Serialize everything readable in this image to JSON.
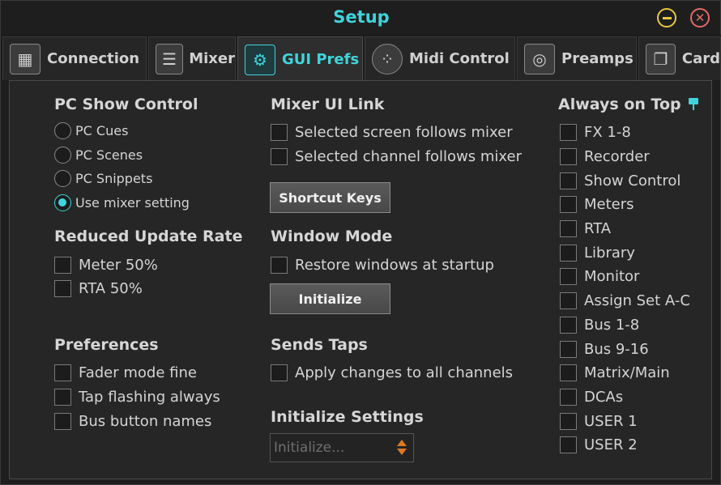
{
  "window": {
    "title": "Setup"
  },
  "tabs": [
    {
      "label": "Connection",
      "icon": "connection-icon"
    },
    {
      "label": "Mixer",
      "icon": "mixer-faders-icon"
    },
    {
      "label": "GUI Prefs",
      "icon": "gears-icon",
      "active": true
    },
    {
      "label": "Midi Control",
      "icon": "midi-din-icon"
    },
    {
      "label": "Preamps",
      "icon": "preamp-knob-icon"
    },
    {
      "label": "Card",
      "icon": "card-icon"
    }
  ],
  "pc_show_control": {
    "heading": "PC Show Control",
    "options": [
      {
        "label": "PC Cues",
        "selected": false
      },
      {
        "label": "PC Scenes",
        "selected": false
      },
      {
        "label": "PC Snippets",
        "selected": false
      },
      {
        "label": "Use mixer setting",
        "selected": true
      }
    ]
  },
  "reduced_update_rate": {
    "heading": "Reduced Update Rate",
    "items": [
      {
        "label": "Meter 50%",
        "checked": false
      },
      {
        "label": "RTA 50%",
        "checked": false
      }
    ]
  },
  "preferences": {
    "heading": "Preferences",
    "items": [
      {
        "label": "Fader mode fine",
        "checked": false
      },
      {
        "label": "Tap flashing always",
        "checked": false
      },
      {
        "label": "Bus button names",
        "checked": false
      }
    ]
  },
  "mixer_ui_link": {
    "heading": "Mixer UI Link",
    "items": [
      {
        "label": "Selected screen follows mixer",
        "checked": false
      },
      {
        "label": "Selected channel follows mixer",
        "checked": false
      }
    ],
    "shortcut_button": "Shortcut Keys"
  },
  "window_mode": {
    "heading": "Window Mode",
    "items": [
      {
        "label": "Restore windows at startup",
        "checked": false
      }
    ],
    "initialize_button": "Initialize"
  },
  "sends_taps": {
    "heading": "Sends Taps",
    "items": [
      {
        "label": "Apply changes to all channels",
        "checked": false
      }
    ]
  },
  "initialize_settings": {
    "heading": "Initialize Settings",
    "placeholder": "Initialize..."
  },
  "always_on_top": {
    "heading": "Always on Top",
    "icon": "pin-icon",
    "items": [
      {
        "label": "FX 1-8",
        "checked": false
      },
      {
        "label": "Recorder",
        "checked": false
      },
      {
        "label": "Show Control",
        "checked": false
      },
      {
        "label": "Meters",
        "checked": false
      },
      {
        "label": "RTA",
        "checked": false
      },
      {
        "label": "Library",
        "checked": false
      },
      {
        "label": "Monitor",
        "checked": false
      },
      {
        "label": "Assign Set A-C",
        "checked": false
      },
      {
        "label": "Bus 1-8",
        "checked": false
      },
      {
        "label": "Bus 9-16",
        "checked": false
      },
      {
        "label": "Matrix/Main",
        "checked": false
      },
      {
        "label": "DCAs",
        "checked": false
      },
      {
        "label": "USER 1",
        "checked": false
      },
      {
        "label": "USER 2",
        "checked": false
      }
    ]
  },
  "colors": {
    "accent": "#3fd4dc",
    "minimize": "#e8c840",
    "close": "#e46a6a",
    "select_arrow": "#e07820"
  }
}
